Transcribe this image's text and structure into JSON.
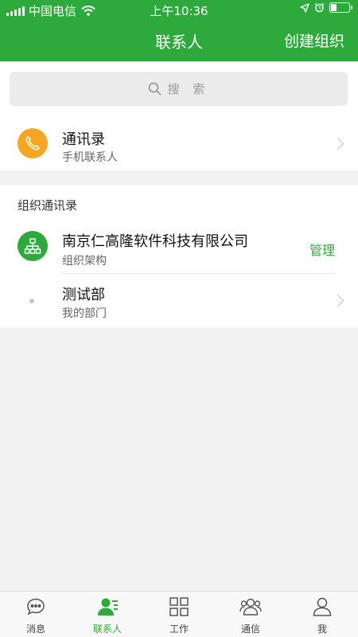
{
  "status_bar": {
    "carrier": "中国电信",
    "time": "上午10:36"
  },
  "nav": {
    "title": "联系人",
    "right_action": "创建组织"
  },
  "search": {
    "placeholder": "搜 索"
  },
  "phone_contacts": {
    "title": "通讯录",
    "subtitle": "手机联系人"
  },
  "org_section": {
    "label": "组织通讯录",
    "org": {
      "name": "南京仁高隆软件科技有限公司",
      "subtitle": "组织架构",
      "action": "管理"
    },
    "dept": {
      "name": "测试部",
      "subtitle": "我的部门"
    }
  },
  "tabbar": {
    "active": "联系人",
    "tabs": [
      {
        "label": "消息",
        "icon": "chat-icon"
      },
      {
        "label": "联系人",
        "icon": "contacts-icon"
      },
      {
        "label": "工作",
        "icon": "grid-icon"
      },
      {
        "label": "通信",
        "icon": "group-icon"
      },
      {
        "label": "我",
        "icon": "person-icon"
      }
    ]
  },
  "colors": {
    "brand_green": "#2eaa3c",
    "phone_icon_bg": "#f5a623",
    "background": "#f2f2f2"
  }
}
